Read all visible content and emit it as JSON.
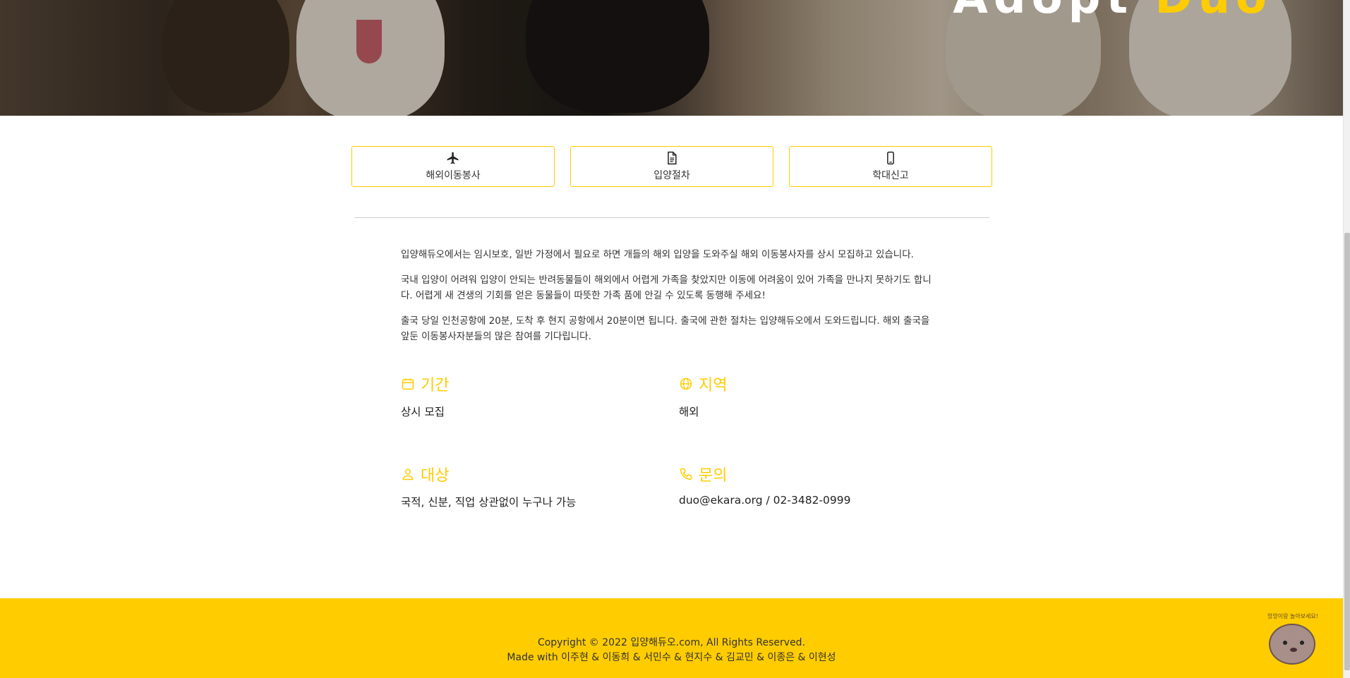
{
  "hero": {
    "title_part1": "Adopt ",
    "title_accent": "Duo"
  },
  "tabs": [
    {
      "label": "해외이동봉사",
      "icon": "airplane-icon"
    },
    {
      "label": "입양절차",
      "icon": "document-icon"
    },
    {
      "label": "학대신고",
      "icon": "phone-icon"
    }
  ],
  "content": {
    "p1": "입양해듀오에서는 임시보호, 일반 가정에서 필요로 하면 개들의 해외 입양을 도와주실 해외 이동봉사자를 상시 모집하고 있습니다.",
    "p2": "국내 입양이 어려워 입양이 안되는 반려동물들이 해외에서 어렵게 가족을 찾았지만 이동에 어려움이 있어 가족을 만나지 못하기도 합니다. 어렵게 새 견생의 기회를 얻은 동물들이 따뜻한 가족 품에 안길 수 있도록 동행해 주세요!",
    "p3": "출국 당일 인천공항에 20분, 도착 후 현지 공항에서 20분이면 됩니다. 출국에 관한 절차는 입양해듀오에서 도와드립니다. 해외 출국을 앞둔 이동봉사자분들의 많은 참여를 기다립니다."
  },
  "info": {
    "period": {
      "title": "기간",
      "value": "상시 모집",
      "icon": "calendar-icon"
    },
    "region": {
      "title": "지역",
      "value": "해외",
      "icon": "globe-icon"
    },
    "target": {
      "title": "대상",
      "value": "국적, 신분, 직업 상관없이 누구나 가능",
      "icon": "person-icon"
    },
    "contact": {
      "title": "문의",
      "value": "duo@ekara.org / 02-3482-0999",
      "icon": "phone-icon"
    }
  },
  "footer": {
    "copyright": "Copyright © 2022 입양해듀오.com, All Rights Reserved.",
    "credits": "Made with 이주현 & 이동희 & 서민수 & 현지수 & 김교민 & 이종은 & 이현성"
  },
  "mascot": {
    "bubble": "앙앙이랑 놀아보세요!"
  },
  "colors": {
    "accent": "#ffcc00",
    "footer_bg": "#ffcc00"
  }
}
